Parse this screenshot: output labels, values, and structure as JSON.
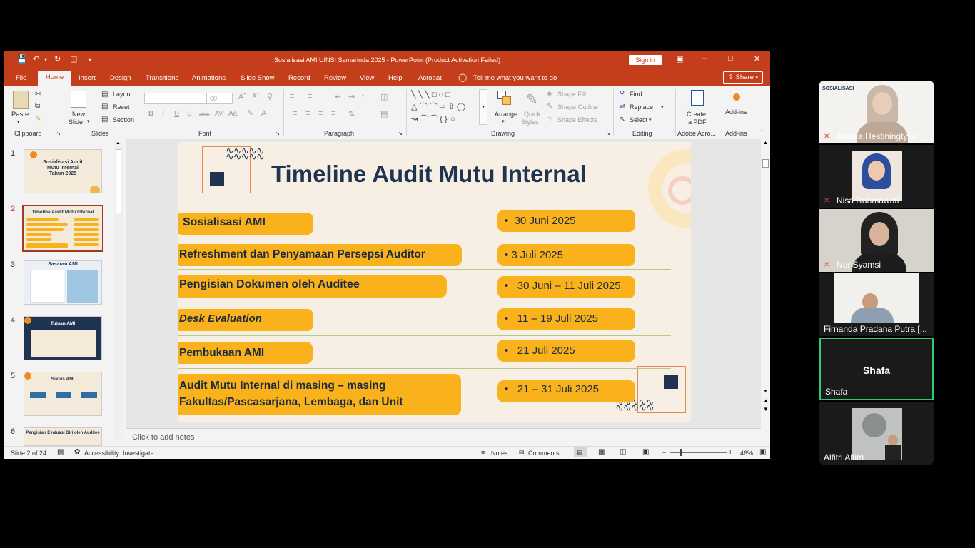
{
  "window": {
    "title": "Sosialisasi AMI UINSI Samarinda 2025  -  PowerPoint (Product Activation Failed)",
    "sign_in": "Sign in"
  },
  "menu": {
    "file": "File",
    "tabs": [
      "Home",
      "Insert",
      "Design",
      "Transitions",
      "Animations",
      "Slide Show",
      "Record",
      "Review",
      "View",
      "Help",
      "Acrobat"
    ],
    "tell_me": "Tell me what you want to do",
    "share": "Share"
  },
  "ribbon": {
    "clipboard": {
      "paste": "Paste",
      "label": "Clipboard"
    },
    "slides": {
      "new_slide": "New",
      "new_slide2": "Slide",
      "layout": "Layout",
      "reset": "Reset",
      "section": "Section",
      "label": "Slides"
    },
    "font": {
      "size": "60",
      "label": "Font"
    },
    "paragraph": {
      "label": "Paragraph"
    },
    "drawing": {
      "arrange": "Arrange",
      "quick_styles": "Quick",
      "quick_styles2": "Styles",
      "shape_fill": "Shape Fill",
      "shape_outline": "Shape Outline",
      "shape_effects": "Shape Effects",
      "label": "Drawing"
    },
    "editing": {
      "find": "Find",
      "replace": "Replace",
      "select": "Select",
      "label": "Editing"
    },
    "adobe": {
      "create_pdf": "Create",
      "create_pdf2": "a PDF",
      "label": "Adobe Acro..."
    },
    "addins": {
      "addins": "Add-ins",
      "label": "Add-ins"
    }
  },
  "thumbnails": [
    {
      "num": "1",
      "title": "Sosialisasi Audit Mutu Internal Tahun 2025"
    },
    {
      "num": "2",
      "title": "Timeline Audit Mutu Internal"
    },
    {
      "num": "3",
      "title": "Sasaran AMI"
    },
    {
      "num": "4",
      "title": "Tujuan AMI"
    },
    {
      "num": "5",
      "title": "Siklus AMI"
    },
    {
      "num": "6",
      "title": "Pengisian Evaluasi Diri oleh Auditee"
    }
  ],
  "slide": {
    "title": "Timeline Audit Mutu Internal",
    "activities": [
      "Sosialisasi AMI",
      "Refreshment dan Penyamaan Persepsi Auditor",
      "Pengisian Dokumen oleh Auditee",
      "Desk Evaluation",
      "Pembukaan AMI",
      "Audit Mutu Internal di masing – masing Fakultas/Pascasarjana, Lembaga, dan Unit"
    ],
    "dates": [
      "30 Juni 2025",
      "3 Juli 2025",
      "30 Juni – 11 Juli 2025",
      "11 – 19 Juli 2025",
      "21 Juli 2025",
      "21 – 31 Juli 2025"
    ]
  },
  "notes_placeholder": "Click to add notes",
  "status": {
    "slide_of": "Slide 2 of 24",
    "accessibility": "Accessibility: Investigate",
    "notes": "Notes",
    "comments": "Comments",
    "zoom": "46%"
  },
  "participants": [
    {
      "name": "Annisa Hestiningtyas",
      "muted": true
    },
    {
      "name": "Nisa Rahmawati",
      "muted": true
    },
    {
      "name": "Nur Syamsi",
      "muted": true
    },
    {
      "name": "Firnanda Pradana Putra [...",
      "muted": false
    },
    {
      "name": "Shafa",
      "muted": false,
      "center_name": "Shafa"
    },
    {
      "name": "Alfitri Alfitri",
      "muted": false
    }
  ],
  "colors": {
    "ppt_accent": "#c43e1c",
    "pill": "#f9b21c",
    "navy": "#1f3450",
    "active_speaker": "#2ecc71"
  }
}
